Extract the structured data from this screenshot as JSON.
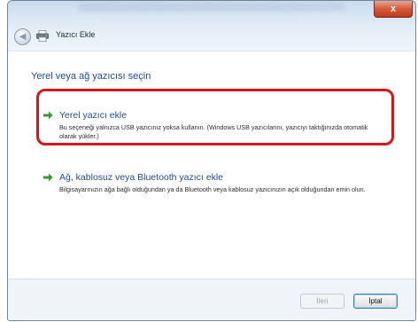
{
  "window": {
    "title": "Yazıcı Ekle",
    "close_glyph": "x"
  },
  "page": {
    "heading": "Yerel veya ağ yazıcısı seçin"
  },
  "options": [
    {
      "title": "Yerel yazıcı ekle",
      "description": "Bu seçeneği yalnızca USB yazıcınız yoksa kullanın. (Windows USB yazıcılarını, yazıcıyı taktığınızda otomatik olarak yükler.)",
      "icon": "green-arrow-icon",
      "highlighted": true
    },
    {
      "title": "Ağ, kablosuz veya Bluetooth yazıcı ekle",
      "description": "Bilgisayarınızın ağa bağlı olduğundan ya da Bluetooth veya kablosuz yazıcınızın açık olduğundan emin olun.",
      "icon": "green-arrow-icon",
      "highlighted": false
    }
  ],
  "footer": {
    "next_label": "İleri",
    "cancel_label": "İptal"
  },
  "colors": {
    "link_blue": "#1d4c9b",
    "highlight_red": "#d6161a",
    "arrow_green": "#2e9e2e"
  }
}
